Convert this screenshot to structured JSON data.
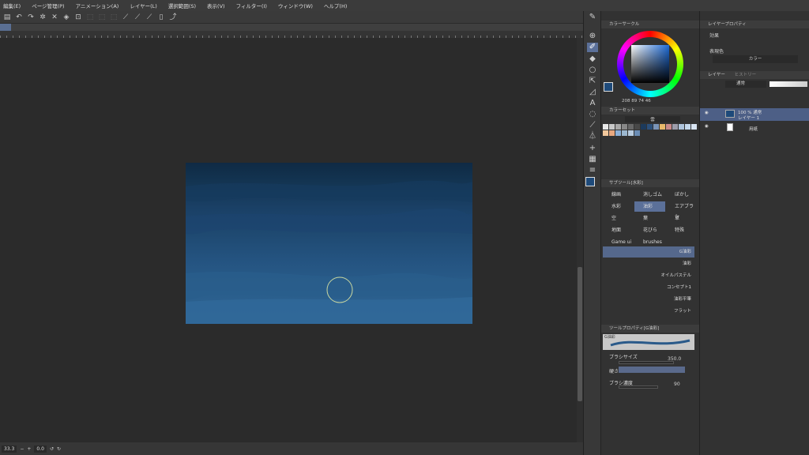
{
  "menu": [
    "編集(E)",
    "ページ管理(P)",
    "アニメーション(A)",
    "レイヤー(L)",
    "選択範囲(S)",
    "表示(V)",
    "フィルター(I)",
    "ウィンドウ(W)",
    "ヘルプ(H)"
  ],
  "status": {
    "zoom": "33.3",
    "angle": "0.0"
  },
  "color_panel": {
    "title": "カラーサークル",
    "hsv": "208 89 74 46",
    "main_color": "#1e4a7a"
  },
  "color_set": {
    "title": "カラーセット",
    "label": "雲"
  },
  "palette": [
    "#e8e8e8",
    "#c8c8c8",
    "#a8a8a8",
    "#888",
    "#686868",
    "#484848",
    "#1c3a5c",
    "#2b4f7a",
    "#7a94b8",
    "#e8b86a",
    "#c88a8a",
    "#9c9caa",
    "#aec4dc",
    "#c4d8ec",
    "#d8e4f2",
    "#f2c89c",
    "#e8a880",
    "#8cb0d8",
    "#9cb8d0",
    "#b8cce0",
    "#6a8cb4"
  ],
  "subtool": {
    "title": "サブツール[水彩]",
    "buttons": [
      [
        "線画",
        "消しゴム",
        "ぼかし"
      ],
      [
        "水彩",
        "油彩",
        "エアブラシ"
      ],
      [
        "空",
        "葉",
        "草"
      ],
      [
        "地面",
        "花びら",
        "特殊"
      ],
      [
        "Game ui",
        "brushes",
        ""
      ]
    ],
    "brushes": [
      "G油彩",
      "油彩",
      "オイルパステル",
      "コンセプト1",
      "油彩平筆",
      "フラット"
    ]
  },
  "tool_property": {
    "title": "ツールプロパティ[G油彩]",
    "preset": "G油彩",
    "size_label": "ブラシサイズ",
    "size_value": "350.0",
    "hardness_label": "硬さ",
    "density_label": "ブラシ濃度",
    "density_value": "90"
  },
  "layer_property": {
    "title": "レイヤープロパティ",
    "effect": "効果",
    "expr_label": "表現色",
    "expr_value": "カラー"
  },
  "layers": {
    "tab": "レイヤー",
    "tab2": "ヒストリー",
    "blend": "通常",
    "items": [
      {
        "name": "100 % 通常",
        "sub": "レイヤー 1"
      },
      {
        "name": "用紙",
        "sub": ""
      }
    ]
  }
}
